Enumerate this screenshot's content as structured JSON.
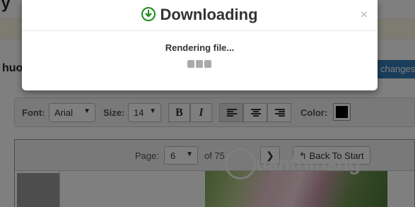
{
  "background": {
    "page_title_fragment": "y",
    "heading_fragment": "huo",
    "changes_button": "changes",
    "toolbar": {
      "font_label": "Font:",
      "font_value": "Arial",
      "size_label": "Size:",
      "size_value": "14",
      "bold_label": "B",
      "italic_label": "I",
      "color_label": "Color:",
      "color_value": "#000000"
    },
    "viewer": {
      "page_label": "Page:",
      "page_value": "6",
      "of_label": "of 75",
      "back_to_start": "Back To Start",
      "next_icon": "chevron-right-icon",
      "back_icon": "back-arrow-icon"
    },
    "watermark": "uantrimang"
  },
  "modal": {
    "title": "Downloading",
    "title_icon": "download-circle-icon",
    "close_label": "×",
    "status": "Rendering file...",
    "accent_color": "#1c8a1c"
  }
}
